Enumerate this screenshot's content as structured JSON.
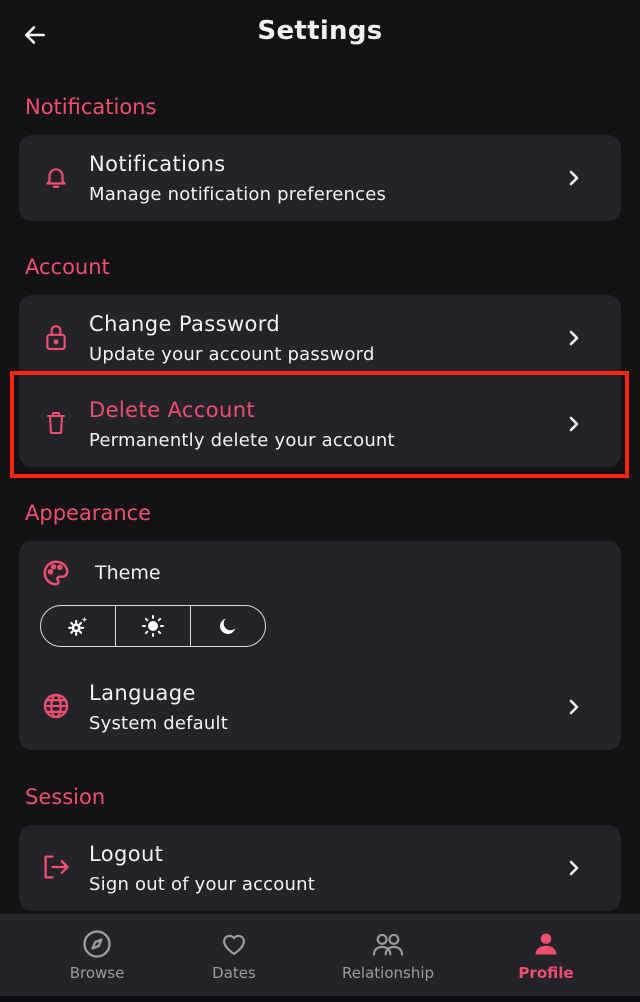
{
  "header": {
    "title": "Settings"
  },
  "sections": {
    "notifications": "Notifications",
    "account": "Account",
    "appearance": "Appearance",
    "session": "Session"
  },
  "rows": {
    "notifications": {
      "title": "Notifications",
      "subtitle": "Manage notification preferences",
      "icon": "bell-icon"
    },
    "change_password": {
      "title": "Change Password",
      "subtitle": "Update your account password",
      "icon": "lock-icon"
    },
    "delete_account": {
      "title": "Delete Account",
      "subtitle": "Permanently delete your account",
      "icon": "trash-icon"
    },
    "theme": {
      "title": "Theme",
      "icon": "palette-icon",
      "options": [
        "system-auto-icon",
        "sun-icon",
        "moon-icon"
      ]
    },
    "language": {
      "title": "Language",
      "subtitle": "System default",
      "icon": "globe-icon"
    },
    "logout": {
      "title": "Logout",
      "subtitle": "Sign out of your account",
      "icon": "logout-icon"
    }
  },
  "bottom_nav": {
    "items": [
      {
        "label": "Browse",
        "icon": "compass-icon",
        "active": false
      },
      {
        "label": "Dates",
        "icon": "heart-icon",
        "active": false
      },
      {
        "label": "Relationship",
        "icon": "people-icon",
        "active": false
      },
      {
        "label": "Profile",
        "icon": "person-icon",
        "active": true
      }
    ]
  },
  "colors": {
    "background": "#131316",
    "card": "#232329",
    "accent": "#ef4f6e",
    "highlight": "#ff2414",
    "text": "#f2f2f2",
    "muted": "#9a9aa2"
  }
}
